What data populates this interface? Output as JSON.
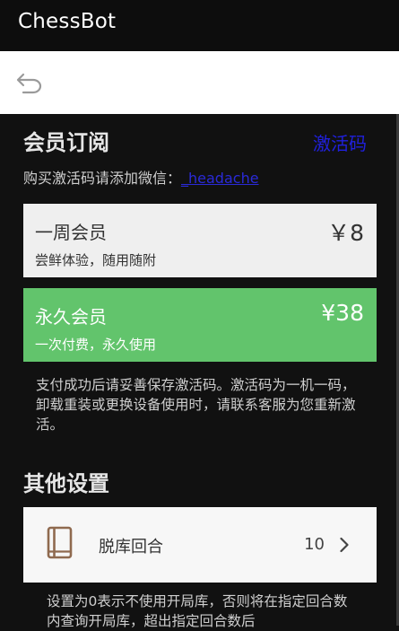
{
  "app": {
    "title": "ChessBot"
  },
  "toolbar": {
    "back_icon": "undo-arrow-icon"
  },
  "membership": {
    "title": "会员订阅",
    "activation_link": "激活码",
    "wechat_prefix": "购买激活码请添加微信：",
    "wechat_id": "_headache",
    "plans": [
      {
        "name": "一周会员",
        "desc": "尝鲜体验，随用随附",
        "price": "￥8",
        "bg": "#efefef"
      },
      {
        "name": "永久会员",
        "desc": "一次付费，永久使用",
        "price": "¥38",
        "bg": "#62c46c"
      }
    ],
    "note": "支付成功后请妥善保存激活码。激活码为一机一码，卸载重装或更换设备使用时，请联系客服为您重新激活。"
  },
  "settings": {
    "title": "其他设置",
    "opening_book": {
      "icon": "book-icon",
      "label": "脱库回合",
      "value": "10",
      "chevron": "chevron-right-icon"
    },
    "note": "设置为0表示不使用开局库，否则将在指定回合数内查询开局库，超出指定回合数后"
  },
  "colors": {
    "link": "#2a2ad8",
    "accent_green": "#62c46c",
    "icon_brown": "#8f6a4f"
  }
}
